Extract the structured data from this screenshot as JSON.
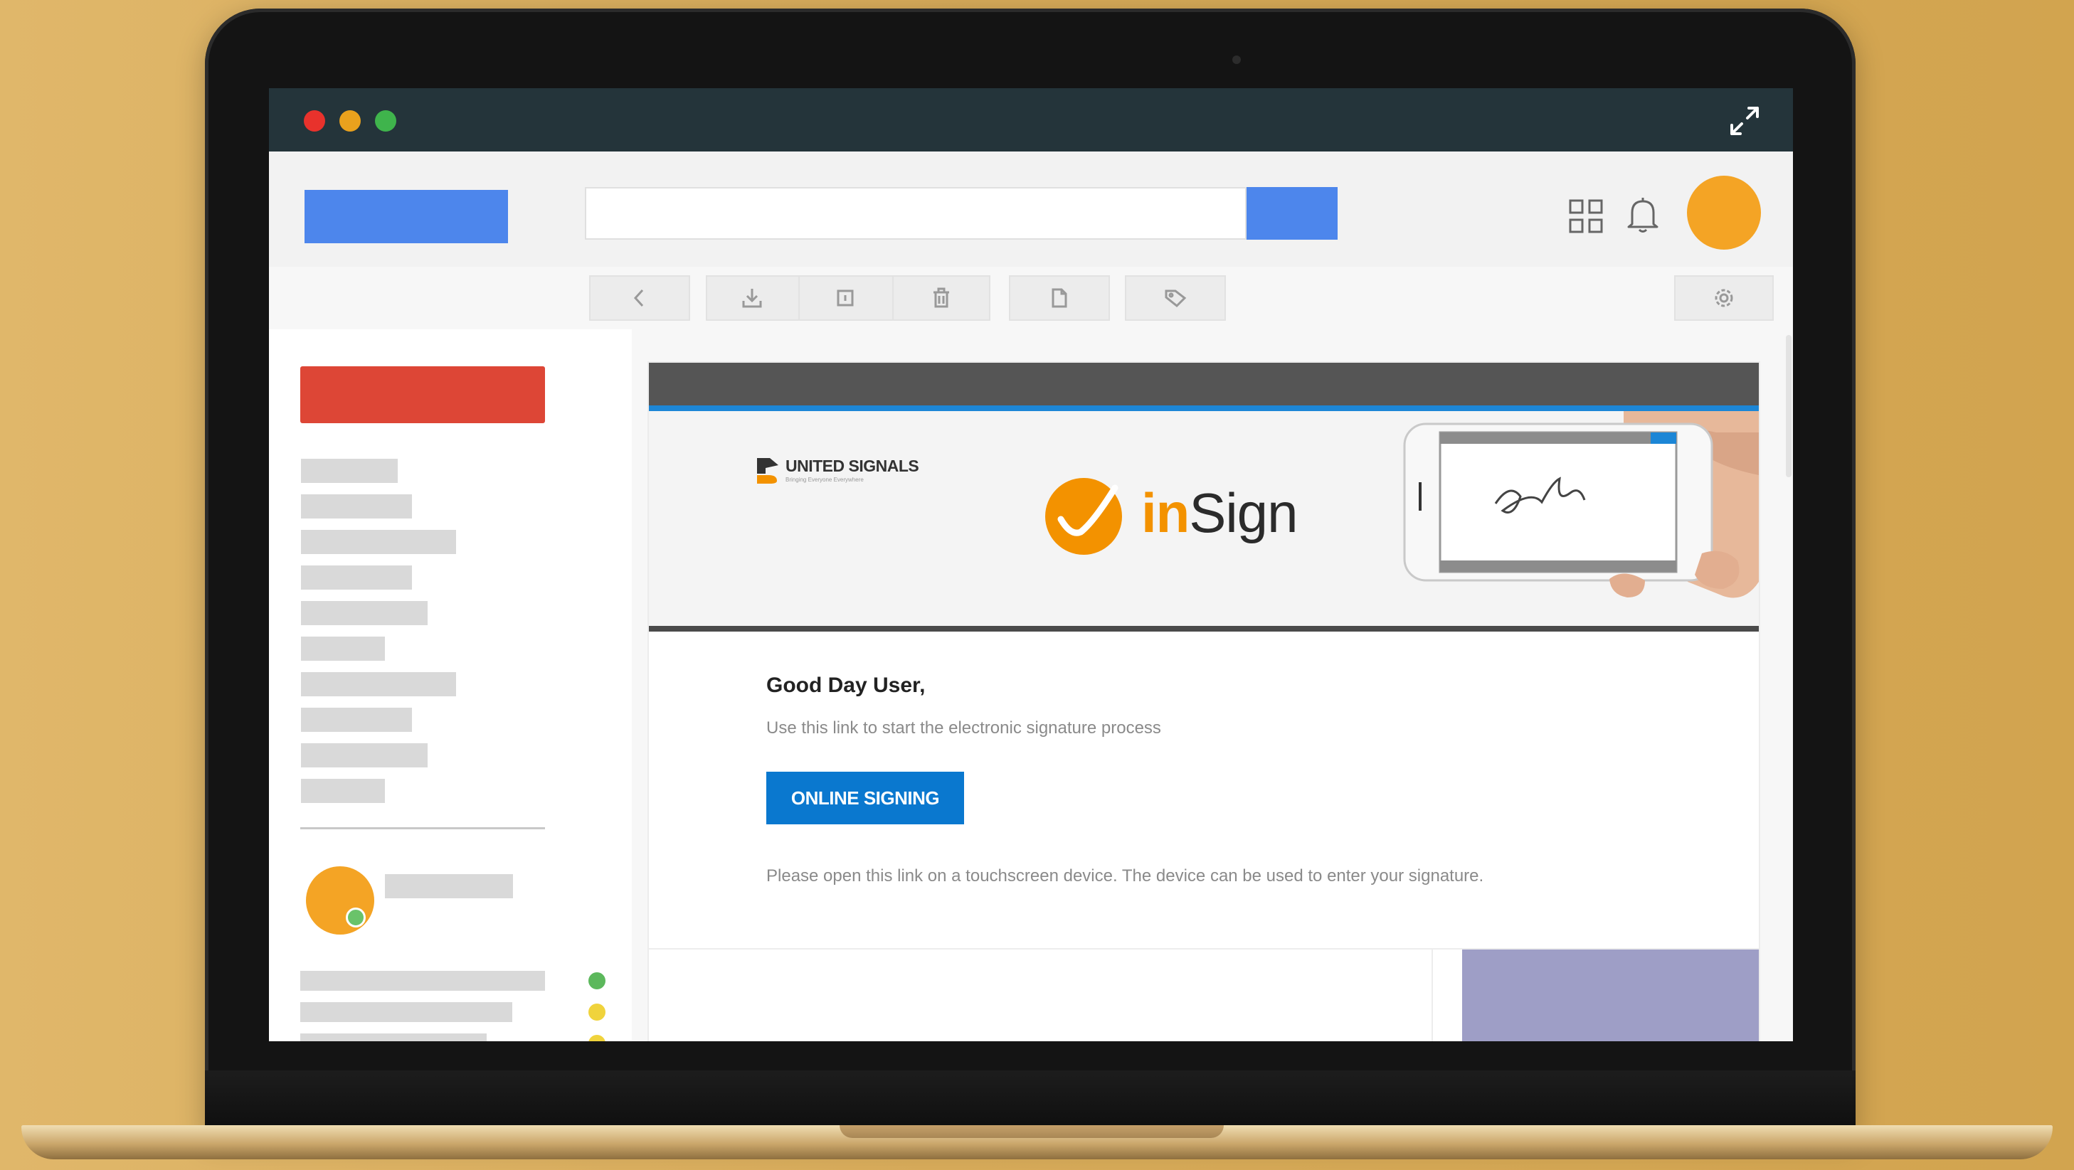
{
  "colors": {
    "titlebar": "#24343a",
    "window_close": "#e8322c",
    "window_minimize": "#e9a11d",
    "window_maximize": "#3fb44c",
    "brand_blue": "#4d86ec",
    "compose_red": "#dd4636",
    "avatar_orange": "#f4a425",
    "signing_button_blue": "#0a78cf",
    "insign_orange": "#f39200"
  },
  "icons": {
    "expand": "expand-arrows-icon",
    "apps": "grid-icon",
    "notifications": "bell-icon",
    "back": "chevron-left-icon",
    "download": "download-icon",
    "archive": "square-icon",
    "delete": "trash-icon",
    "file": "document-icon",
    "label": "tag-icon",
    "settings": "gear-icon"
  },
  "search": {
    "placeholder": ""
  },
  "email": {
    "sender_brand": "UNITED SIGNALS",
    "sender_tagline": "Bringing Everyone Everywhere",
    "product_prefix": "in",
    "product_suffix": "Sign",
    "greeting": "Good Day User,",
    "intro": "Use this link to start the electronic signature process",
    "button_label": "ONLINE SIGNING",
    "note": "Please open this link on a touchscreen device. The device can be used to enter your signature."
  },
  "sidebar": {
    "contact_status": "online",
    "chat_statuses": [
      "#5cb85c",
      "#f0d33c",
      "#f0d33c"
    ]
  }
}
